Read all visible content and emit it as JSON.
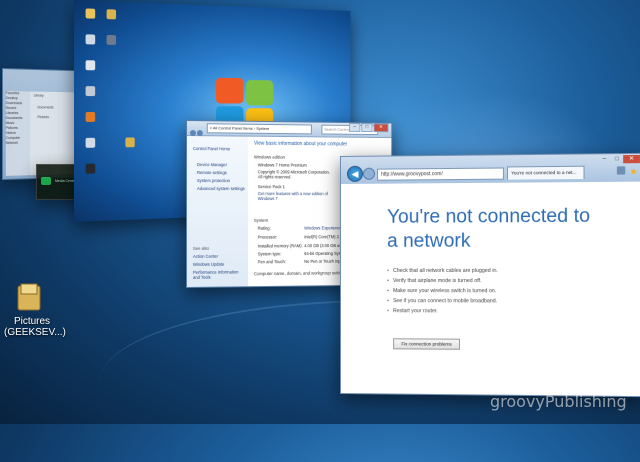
{
  "desktop": {
    "folder_label": "Pictures\n(GEEKSEV...)"
  },
  "explorer": {
    "sidebar": [
      "Favorites",
      "Desktop",
      "Downloads",
      "Recent",
      "Libraries",
      "Documents",
      "Music",
      "Pictures",
      "Videos",
      "Computer",
      "Network"
    ],
    "library": "Library",
    "items": [
      "Documents",
      "Pictures"
    ]
  },
  "media": {
    "label": "Media Center"
  },
  "control_panel": {
    "address": "« All Control Panel Items › System",
    "search": "Search Control Panel",
    "left_nav": {
      "home": "Control Panel Home",
      "links": [
        "Device Manager",
        "Remote settings",
        "System protection",
        "Advanced system settings"
      ],
      "see_also": "See also",
      "see_links": [
        "Action Center",
        "Windows Update",
        "Performance Information and Tools"
      ]
    },
    "main": {
      "heading": "View basic information about your computer",
      "edition_heading": "Windows edition",
      "edition": "Windows 7 Home Premium",
      "copyright": "Copyright © 2009 Microsoft Corporation. All rights reserved.",
      "service_pack": "Service Pack 1",
      "upgrade_link": "Get more features with a new edition of Windows 7",
      "system_heading": "System",
      "rows": [
        {
          "label": "Rating:",
          "value": "Windows Experience Index"
        },
        {
          "label": "Processor:",
          "value": "Intel(R) Core(TM) 2.79 GHz"
        },
        {
          "label": "Installed memory (RAM):",
          "value": "4.00 GB (3.00 GB usable)"
        },
        {
          "label": "System type:",
          "value": "64-bit Operating System"
        },
        {
          "label": "Pen and Touch:",
          "value": "No Pen or Touch Input"
        }
      ],
      "footer": "Computer name, domain, and workgroup settings"
    }
  },
  "ie": {
    "address": "http://www.groovypost.com/",
    "tab": "You're not connected to a net...",
    "heading": "You're not connected to a network",
    "checklist": [
      "Check that all network cables are plugged in.",
      "Verify that airplane mode is turned off.",
      "Make sure your wireless switch is turned on.",
      "See if you can connect to mobile broadband.",
      "Restart your router."
    ],
    "button": "Fix connection problems"
  },
  "watermark": "groovyPublishing",
  "colors": {
    "ie_heading": "#2e6cb4",
    "link": "#1e3e78",
    "close": "#c94e3d"
  }
}
